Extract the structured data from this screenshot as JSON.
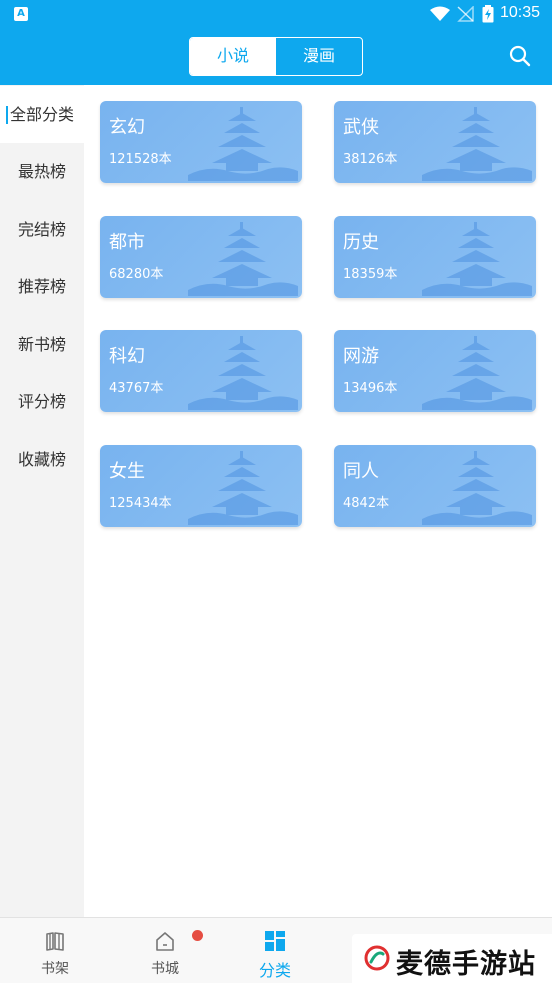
{
  "status_bar": {
    "time": "10:35",
    "app_icon_letter": "A"
  },
  "header": {
    "tabs": [
      {
        "label": "小说",
        "active": true
      },
      {
        "label": "漫画",
        "active": false
      }
    ],
    "search_icon": "search-icon"
  },
  "sidebar": {
    "items": [
      {
        "label": "全部分类",
        "active": true
      },
      {
        "label": "最热榜"
      },
      {
        "label": "完结榜"
      },
      {
        "label": "推荐榜"
      },
      {
        "label": "新书榜"
      },
      {
        "label": "评分榜"
      },
      {
        "label": "收藏榜"
      }
    ]
  },
  "categories": [
    {
      "name": "玄幻",
      "count": "121528本"
    },
    {
      "name": "武侠",
      "count": "38126本"
    },
    {
      "name": "都市",
      "count": "68280本"
    },
    {
      "name": "历史",
      "count": "18359本"
    },
    {
      "name": "科幻",
      "count": "43767本"
    },
    {
      "name": "网游",
      "count": "13496本"
    },
    {
      "name": "女生",
      "count": "125434本"
    },
    {
      "name": "同人",
      "count": "4842本"
    }
  ],
  "bottom_nav": {
    "items": [
      {
        "label": "书架",
        "icon": "bookshelf-icon"
      },
      {
        "label": "书城",
        "icon": "home-icon",
        "badge": true
      },
      {
        "label": "分类",
        "icon": "category-icon",
        "active": true
      }
    ]
  },
  "watermark": {
    "text": "麦德手游站"
  },
  "colors": {
    "accent": "#0ea8ee",
    "card": "#80b8f0",
    "badge": "#e54d42"
  }
}
